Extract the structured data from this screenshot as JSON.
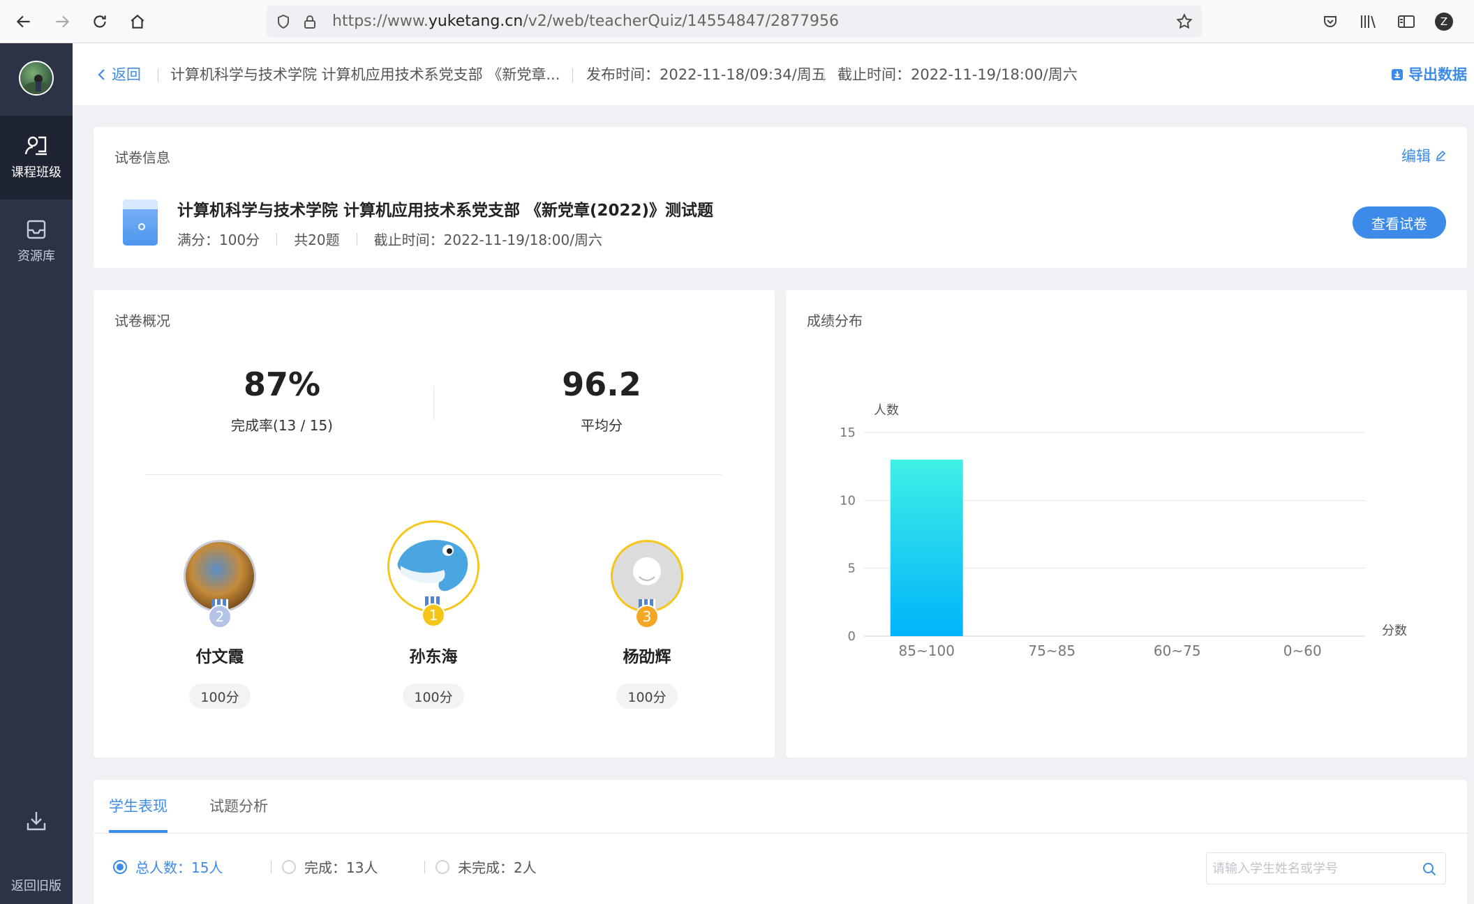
{
  "browser": {
    "url_prefix": "https://www.",
    "url_host": "yuketang.cn",
    "url_path": "/v2/web/teacherQuiz/14554847/2877956",
    "profile_initial": "Z"
  },
  "sidebar": {
    "items": [
      {
        "label": "课程班级"
      },
      {
        "label": "资源库"
      }
    ],
    "bottom_label": "返回旧版"
  },
  "header": {
    "back_label": "返回",
    "title": "计算机科学与技术学院 计算机应用技术系党支部 《新党章...",
    "publish_time": "发布时间：2022-11-18/09:34/周五",
    "deadline": "截止时间：2022-11-19/18:00/周六",
    "export_label": "导出数据"
  },
  "quiz_info": {
    "section_title": "试卷信息",
    "edit_label": "编辑",
    "title": "计算机科学与技术学院 计算机应用技术系党支部 《新党章(2022)》测试题",
    "full_score": "满分：100分",
    "question_count": "共20题",
    "deadline": "截止时间：2022-11-19/18:00/周六",
    "view_button": "查看试卷"
  },
  "overview": {
    "section_title": "试卷概况",
    "completion_rate": "87%",
    "completion_label": "完成率(13 / 15)",
    "average_score": "96.2",
    "average_label": "平均分",
    "ranking": [
      {
        "rank": "2",
        "name": "付文霞",
        "score": "100分"
      },
      {
        "rank": "1",
        "name": "孙东海",
        "score": "100分"
      },
      {
        "rank": "3",
        "name": "杨劭辉",
        "score": "100分"
      }
    ]
  },
  "chart_data": {
    "type": "bar",
    "title": "成绩分布",
    "ylabel": "人数",
    "xlabel": "分数",
    "categories": [
      "85~100",
      "75~85",
      "60~75",
      "0~60"
    ],
    "values": [
      13,
      0,
      0,
      0
    ],
    "ylim": [
      0,
      15
    ],
    "yticks": [
      0,
      5,
      10,
      15
    ],
    "grid": true,
    "bar_colors": [
      "#3ff0e6",
      "#00b4fa"
    ]
  },
  "tabs": {
    "items": [
      {
        "label": "学生表现",
        "active": true
      },
      {
        "label": "试题分析",
        "active": false
      }
    ]
  },
  "filters": {
    "total": "总人数：15人",
    "done": "完成：13人",
    "undone": "未完成：2人",
    "search_placeholder": "请输入学生姓名或学号"
  },
  "colors": {
    "accent": "#3d8be8",
    "sidebar": "#2d3346"
  }
}
